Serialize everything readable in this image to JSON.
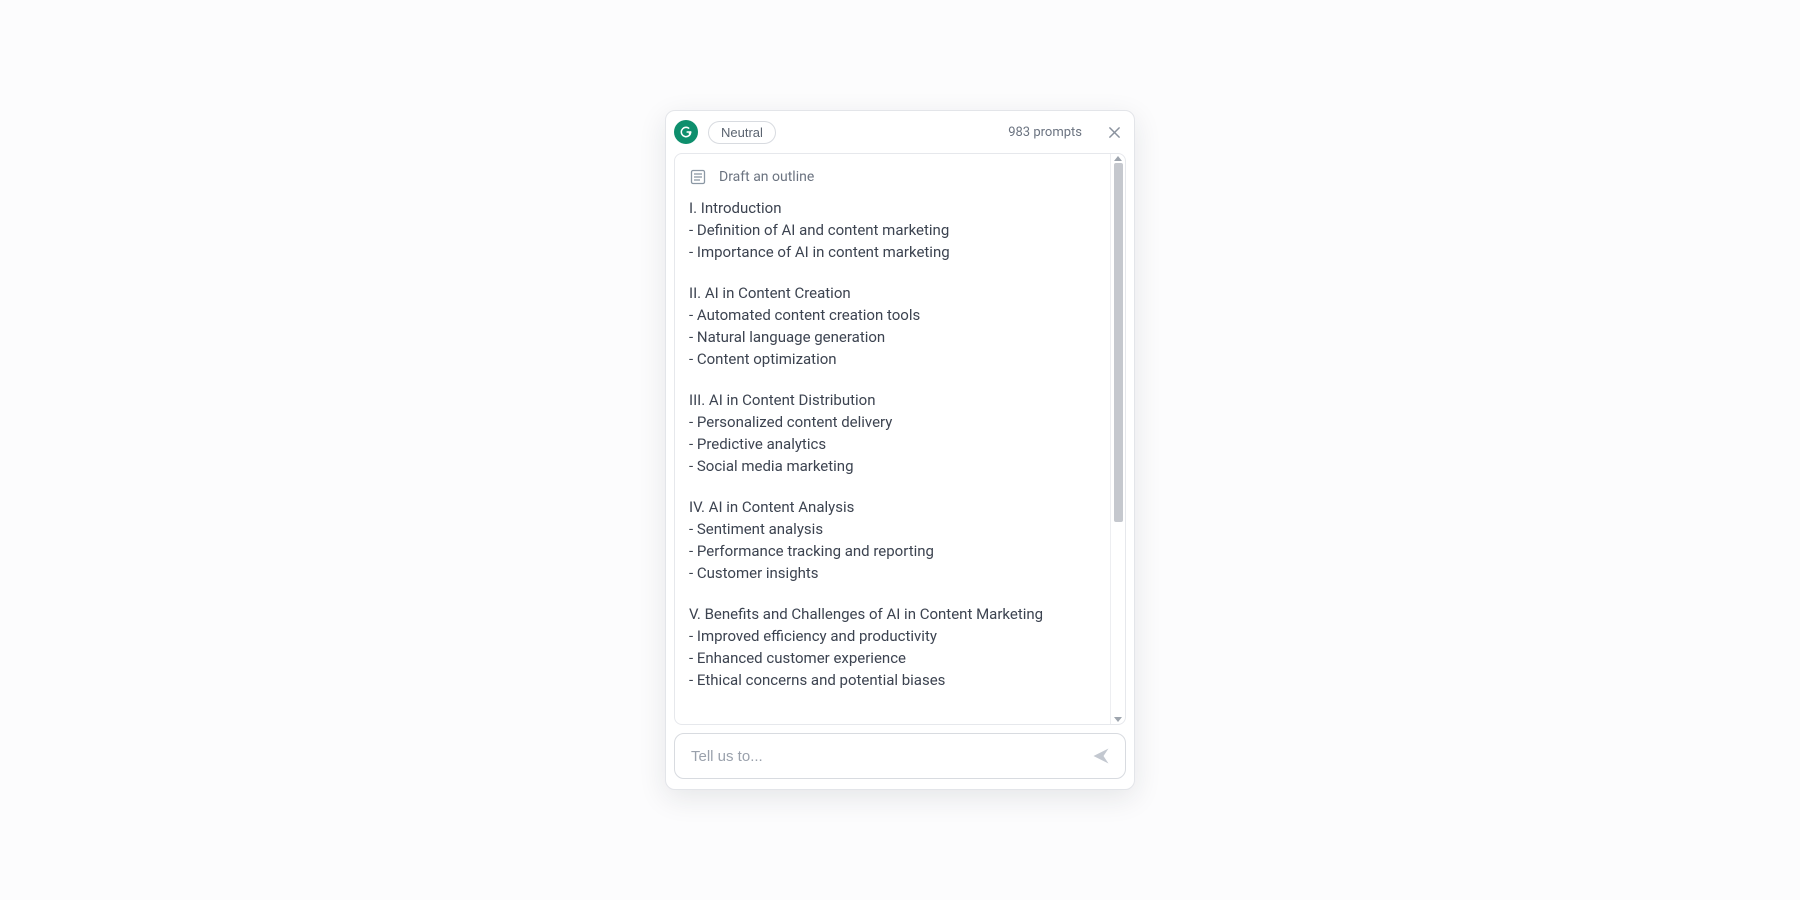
{
  "header": {
    "tone_label": "Neutral",
    "prompts_label": "983 prompts"
  },
  "action": {
    "label": "Draft an outline"
  },
  "outline": [
    {
      "heading": "I. Introduction",
      "bullets": [
        "- Definition of AI and content marketing",
        "- Importance of AI in content marketing"
      ]
    },
    {
      "heading": "II. AI in Content Creation",
      "bullets": [
        "- Automated content creation tools",
        "- Natural language generation",
        "- Content optimization"
      ]
    },
    {
      "heading": "III. AI in Content Distribution",
      "bullets": [
        "- Personalized content delivery",
        "- Predictive analytics",
        "- Social media marketing"
      ]
    },
    {
      "heading": "IV. AI in Content Analysis",
      "bullets": [
        "- Sentiment analysis",
        "- Performance tracking and reporting",
        "- Customer insights"
      ]
    },
    {
      "heading": "V. Benefits and Challenges of AI in Content Marketing",
      "bullets": [
        "- Improved efficiency and productivity",
        "- Enhanced customer experience",
        "- Ethical concerns and potential biases"
      ]
    }
  ],
  "input": {
    "placeholder": "Tell us to..."
  }
}
